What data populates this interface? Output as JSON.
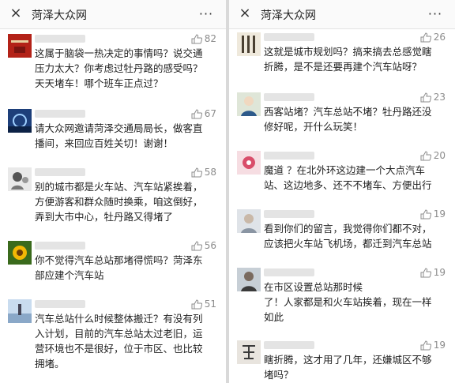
{
  "left": {
    "title": "菏泽大众网",
    "close_icon": "×",
    "more_icon": "···",
    "comments": [
      {
        "likes": "82",
        "text": "这属于脑袋一热决定的事情吗？说交通\n压力太大？你考虑过牡丹路的感受吗？\n天天堵车！哪个班车正点过？"
      },
      {
        "likes": "67",
        "text": "请大众网邀请菏泽交通局局长，做客直\n播间，来回应百姓关切！谢谢！"
      },
      {
        "likes": "58",
        "text": "别的城市都是火车站、汽车站紧挨着，\n方便游客和群众随时换乘，咱这倒好，\n弄到大市中心，牡丹路又得堵了"
      },
      {
        "likes": "56",
        "text": "你不觉得汽车总站那堵得慌吗？菏泽东\n部应建个汽车站"
      },
      {
        "likes": "51",
        "text": "汽车总站什么时候整体搬迁？有没有列\n入计划，目前的汽车总站太过老旧，运\n营环境也不是很好，位于市区、也比较\n拥堵。"
      }
    ]
  },
  "right": {
    "title": "菏泽大众网",
    "close_icon": "×",
    "more_icon": "···",
    "comments": [
      {
        "likes": "26",
        "text": "这就是城市规划吗？搞来搞去总感觉瞎\n折腾，是不是还要再建个汽车站呀？"
      },
      {
        "likes": "23",
        "text": "西客站堵？汽车总站不堵？牡丹路还没\n修好呢，开什么玩笑！"
      },
      {
        "likes": "20",
        "text": "魔道 ？在北外环这边建一个大点汽车\n站、这边地多、还不不堵车、方便出行"
      },
      {
        "likes": "19",
        "text": "看到你们的留言，我觉得你们都不对，\n应该把火车站飞机场，都迁到汽车总站"
      },
      {
        "likes": "19",
        "text": "在市区设置总站那时候\n了！人家都是和火车站挨着，现在一样\n如此"
      },
      {
        "likes": "19",
        "text": "瞎折腾，这才用了几年，还嫌城区不够\n堵吗？"
      }
    ]
  },
  "colors": {
    "like_gray": "#8c8c8c",
    "text": "#222222"
  }
}
